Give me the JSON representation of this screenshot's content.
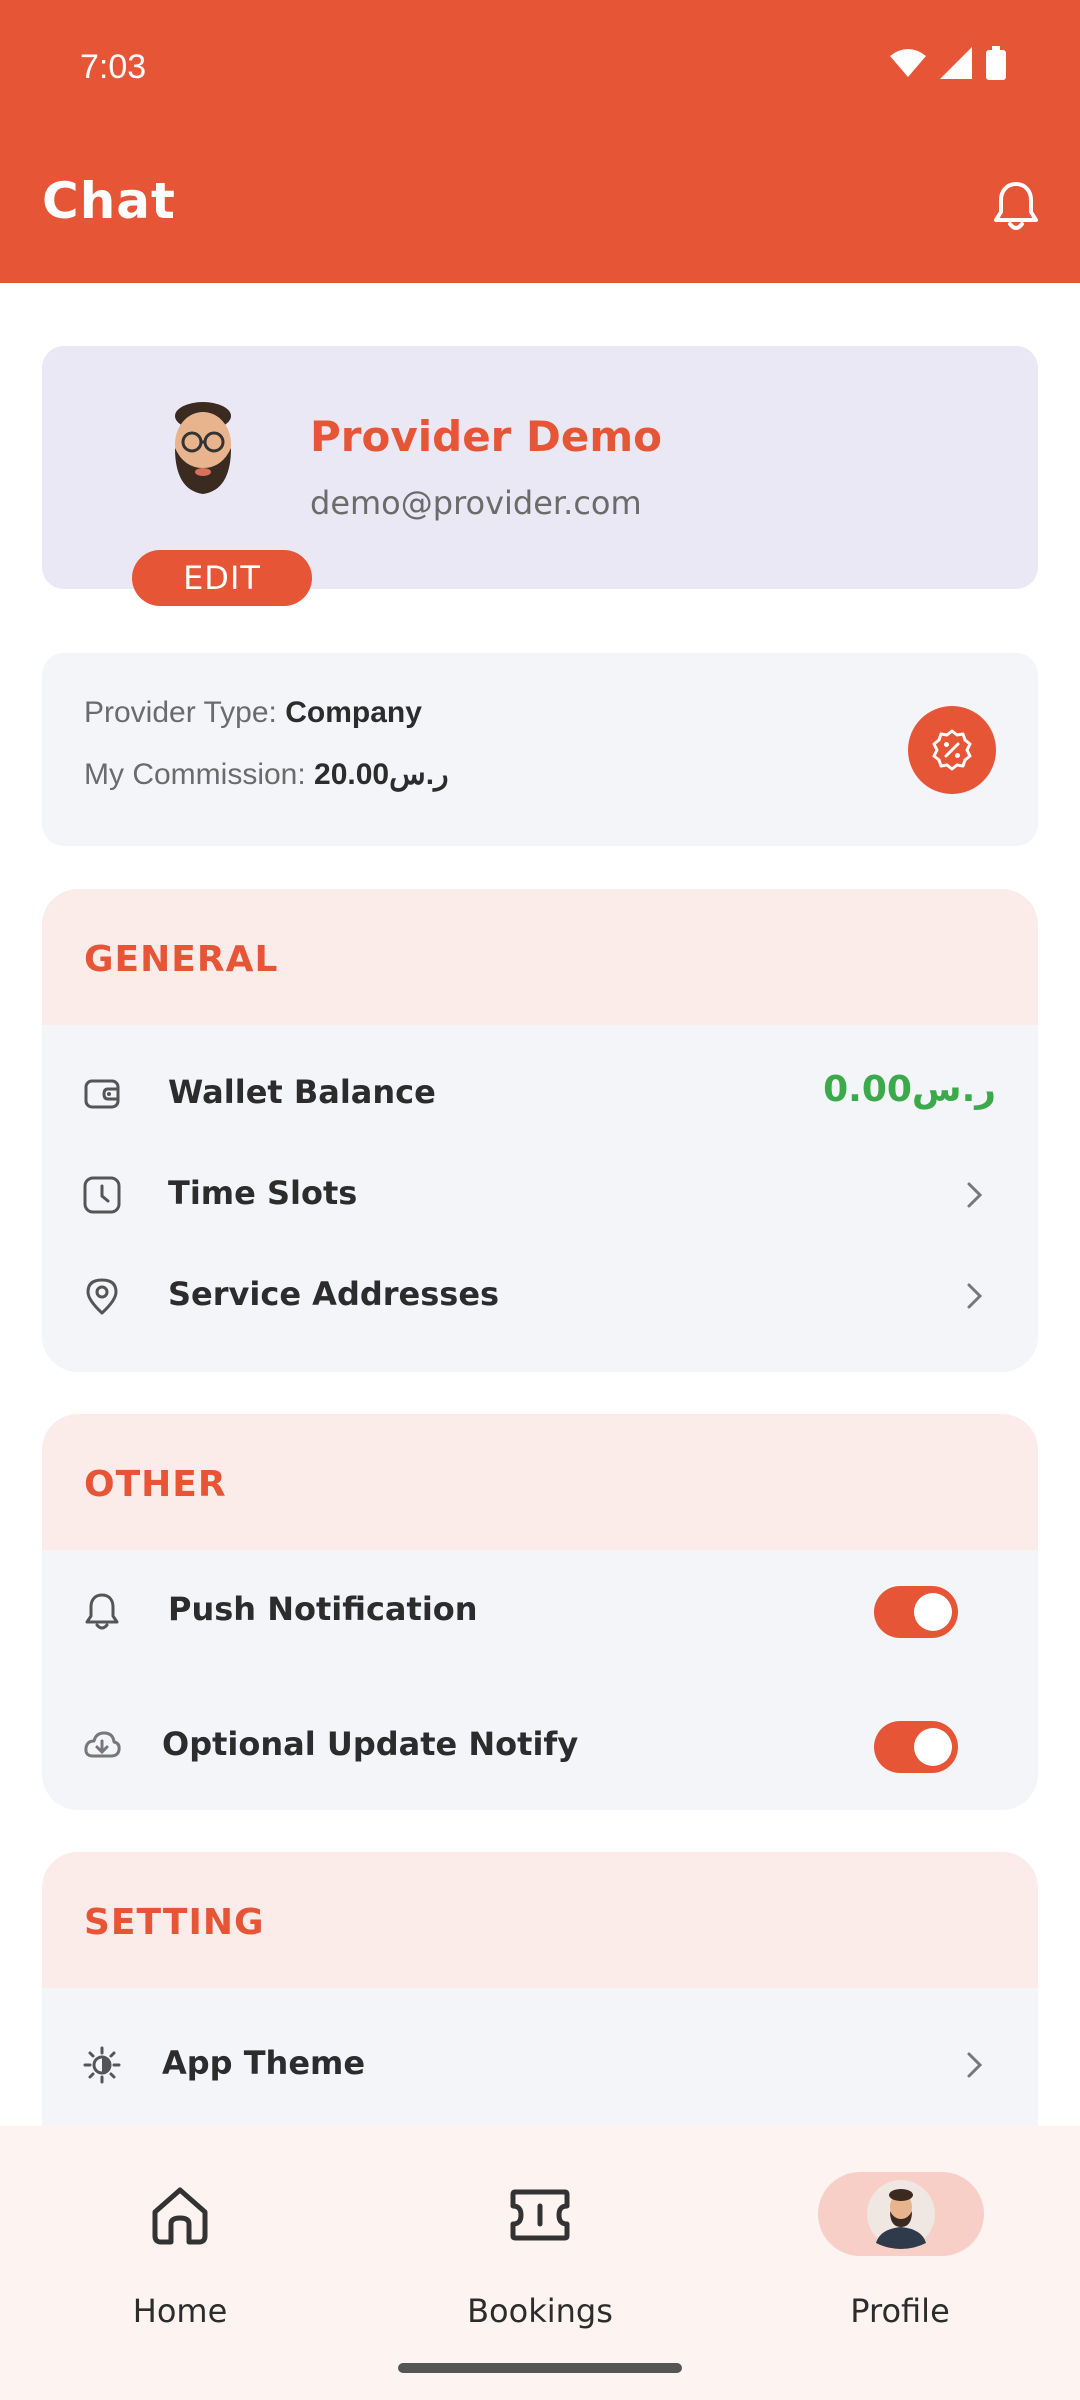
{
  "status_bar": {
    "time": "7:03"
  },
  "header": {
    "title": "Chat"
  },
  "profile": {
    "name": "Provider Demo",
    "email": "demo@provider.com",
    "edit_label": "EDIT"
  },
  "provider_info": {
    "type_label": "Provider Type:",
    "type_value": "Company",
    "commission_label": "My Commission:",
    "commission_value": "20.00ر.س"
  },
  "general": {
    "title": "GENERAL",
    "wallet_label": "Wallet Balance",
    "wallet_value": "0.00ر.س",
    "time_slots_label": "Time Slots",
    "service_addresses_label": "Service Addresses"
  },
  "other": {
    "title": "OTHER",
    "push_label": "Push Notification",
    "update_label": "Optional Update Notify"
  },
  "setting": {
    "title": "SETTING",
    "theme_label": "App Theme"
  },
  "bottom_nav": {
    "home": "Home",
    "bookings": "Bookings",
    "profile": "Profile"
  },
  "colors": {
    "primary": "#E55536",
    "wallet_green": "#3BAA4A",
    "section_head_bg": "#FCECE9",
    "card_bg": "#F4F5F9"
  }
}
